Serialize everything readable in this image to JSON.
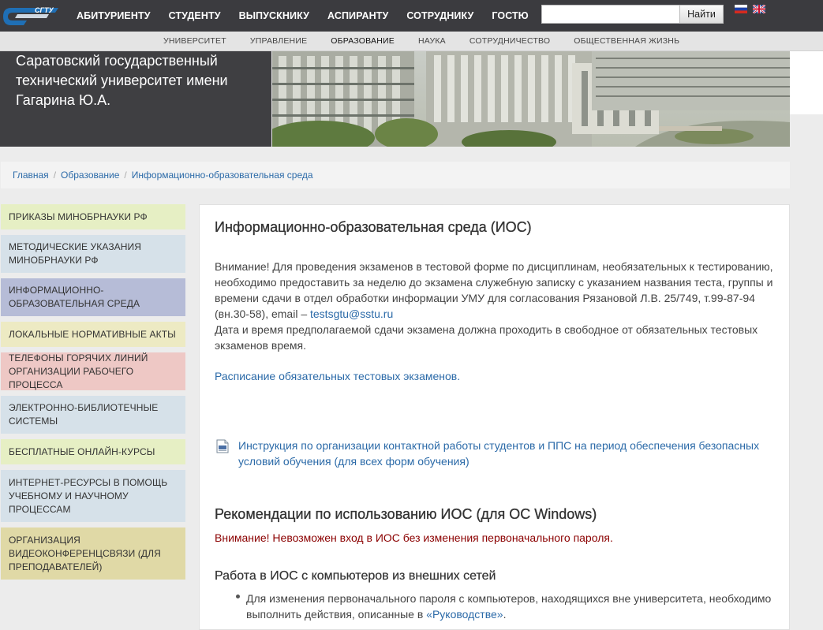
{
  "header": {
    "logo_text": "СГТУ",
    "nav": [
      "АБИТУРИЕНТУ",
      "СТУДЕНТУ",
      "ВЫПУСКНИКУ",
      "АСПИРАНТУ",
      "СОТРУДНИКУ",
      "ГОСТЮ"
    ],
    "search": {
      "placeholder": "",
      "button_label": "Найти"
    },
    "flags": [
      "russian-flag-icon",
      "uk-flag-icon"
    ]
  },
  "subnav": {
    "items": [
      "УНИВЕРСИТЕТ",
      "УПРАВЛЕНИЕ",
      "ОБРАЗОВАНИЕ",
      "НАУКА",
      "СОТРУДНИЧЕСТВО",
      "ОБЩЕСТВЕННАЯ ЖИЗНЬ"
    ],
    "active": "ОБРАЗОВАНИЕ"
  },
  "banner": {
    "title": "Саратовский государственный технический университет имени Гагарина Ю.А."
  },
  "breadcrumb": [
    "Главная",
    "Образование",
    "Информационно-образовательная среда"
  ],
  "sidebar": {
    "items": [
      {
        "label": "ПРИКАЗЫ МИНОБРНАУКИ РФ",
        "color": "#e6efc4"
      },
      {
        "label": "МЕТОДИЧЕСКИЕ УКАЗАНИЯ МИНОБРНАУКИ РФ",
        "color": "#d6e1e9"
      },
      {
        "label": "ИНФОРМАЦИОННО-ОБРАЗОВАТЕЛЬНАЯ СРЕДА",
        "color": "#b6bcd7"
      },
      {
        "label": "ЛОКАЛЬНЫЕ НОРМАТИВНЫЕ АКТЫ",
        "color": "#edeac3"
      },
      {
        "label": "ТЕЛЕФОНЫ ГОРЯЧИХ ЛИНИЙ ОРГАНИЗАЦИИ РАБОЧЕГО ПРОЦЕССА",
        "color": "#eec8c5"
      },
      {
        "label": "ЭЛЕКТРОННО-БИБЛИОТЕЧНЫЕ СИСТЕМЫ",
        "color": "#d6e1e9"
      },
      {
        "label": "БЕСПЛАТНЫЕ ОНЛАЙН-КУРСЫ",
        "color": "#e6efc4"
      },
      {
        "label": "ИНТЕРНЕТ-РЕСУРСЫ В ПОМОЩЬ УЧЕБНОМУ И НАУЧНОМУ ПРОЦЕССАМ",
        "color": "#d6e1e9"
      },
      {
        "label": "ОРГАНИЗАЦИЯ ВИДЕОКОНФЕРЕНЦСВЯЗИ (ДЛЯ ПРЕПОДАВАТЕЛЕЙ)",
        "color": "#e0d9a6"
      }
    ]
  },
  "main": {
    "title": "Информационно-образовательная среда (ИОС)",
    "notice_text": "Внимание! Для проведения экзаменов в тестовой форме по дисциплинам, необязательных к тестированию, необходимо предоставить за неделю до экзамена служебную записку с указанием названия теста, группы и времени сдачи в отдел обработки информации УМУ для согласования Рязановой Л.В. 25/749, т.99-87-94 (вн.30-58), email – ",
    "notice_email": "testsgtu@sstu.ru",
    "notice_text2": "Дата и время предполагаемой сдачи экзамена должна проходить в свободное от обязательных тестовых экзаменов время.",
    "schedule_link": "Расписание обязательных тестовых экзаменов.",
    "instruction_link": "Инструкция по организации контактной работы студентов и ППС на период обеспечения безопасных условий обучения (для всех форм обучения)",
    "recommendations_title": "Рекомендации по использованию ИОС (для ОС Windows)",
    "warning": "Внимание!  Невозможен вход в ИОС без изменения первоначального пароля.",
    "external_title": "Работа в ИОС с компьютеров из внешних сетей",
    "bullet_text": "Для изменения первоначального пароля с компьютеров, находящихся вне университета, необходимо выполнить действия, описанные в ",
    "bullet_link": "«Руководстве»",
    "bullet_end": "."
  }
}
